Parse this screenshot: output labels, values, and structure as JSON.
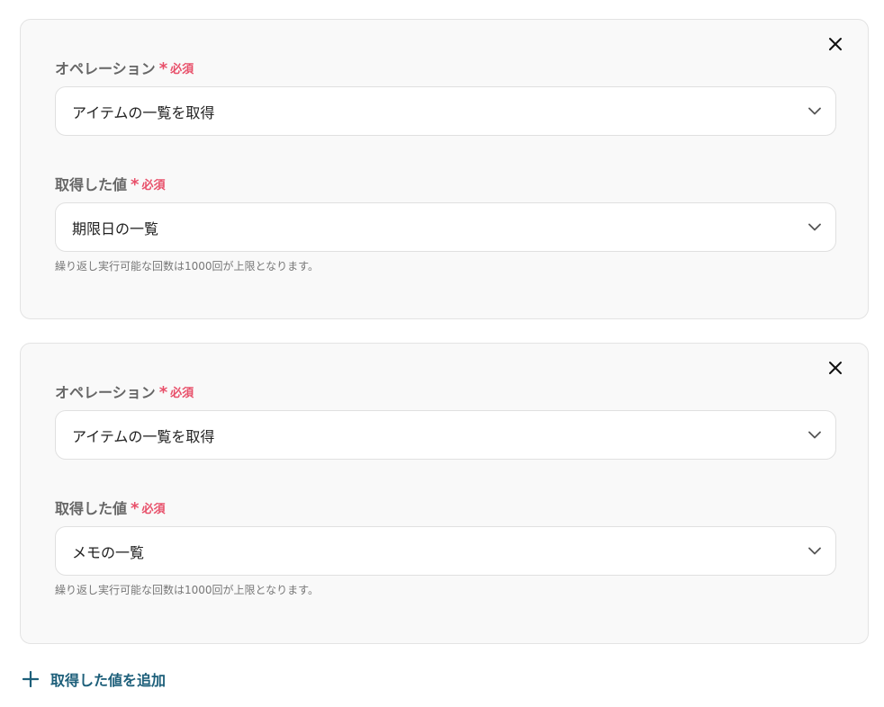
{
  "blocks": [
    {
      "operation": {
        "label": "オペレーション",
        "required_mark": "*",
        "required_text": "必須",
        "value": "アイテムの一覧を取得"
      },
      "value_field": {
        "label": "取得した値",
        "required_mark": "*",
        "required_text": "必須",
        "value": "期限日の一覧"
      },
      "helper": "繰り返し実行可能な回数は1000回が上限となります。"
    },
    {
      "operation": {
        "label": "オペレーション",
        "required_mark": "*",
        "required_text": "必須",
        "value": "アイテムの一覧を取得"
      },
      "value_field": {
        "label": "取得した値",
        "required_mark": "*",
        "required_text": "必須",
        "value": "メモの一覧"
      },
      "helper": "繰り返し実行可能な回数は1000回が上限となります。"
    }
  ],
  "add_button": {
    "label": "取得した値を追加"
  },
  "icons": {
    "close": "close-icon",
    "chevron": "chevron-down-icon",
    "plus": "plus-icon"
  },
  "colors": {
    "required": "#e8506a",
    "accent": "#1d5f7a",
    "card_bg": "#f9f9f9"
  }
}
